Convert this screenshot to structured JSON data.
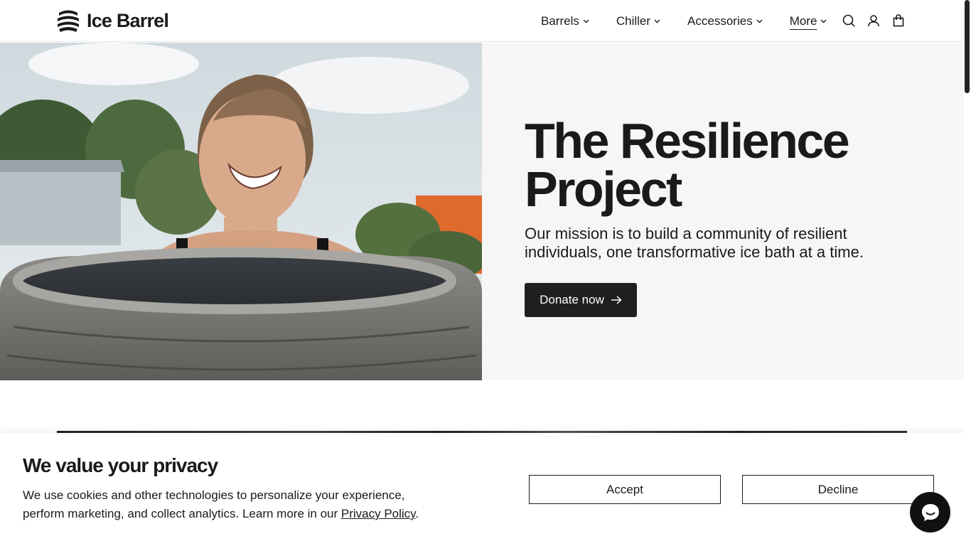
{
  "brand": {
    "name": "Ice Barrel"
  },
  "nav": {
    "items": [
      {
        "label": "Barrels"
      },
      {
        "label": "Chiller"
      },
      {
        "label": "Accessories"
      },
      {
        "label": "More"
      }
    ],
    "icons": [
      "search-icon",
      "account-icon",
      "cart-icon"
    ]
  },
  "hero": {
    "title_line1": "The Resilience",
    "title_line2": "Project",
    "subtitle": "Our mission is to build a community of resilient individuals, one transformative ice bath at a time.",
    "cta_label": "Donate now"
  },
  "cookie": {
    "title": "We value your privacy",
    "text": "We use cookies and other technologies to personalize your experience, perform marketing, and collect analytics. Learn more in our ",
    "link_label": "Privacy Policy",
    "text_end": ".",
    "accept_label": "Accept",
    "decline_label": "Decline"
  },
  "colors": {
    "primary": "#1f1f1f",
    "hero_bg": "#f6f6f6"
  }
}
